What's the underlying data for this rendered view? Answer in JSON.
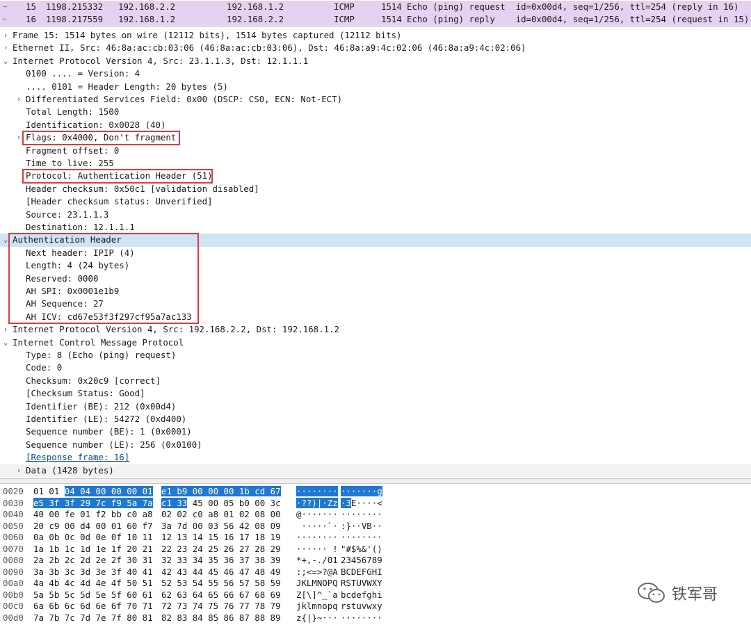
{
  "packet_list": [
    {
      "no": "15",
      "time": "1198.215332",
      "src": "192.168.2.2",
      "dst": "192.168.1.2",
      "proto": "ICMP",
      "len": "1514",
      "info": "Echo (ping) request  id=0x00d4, seq=1/256, ttl=254 (reply in 16)",
      "gutter": "→"
    },
    {
      "no": "16",
      "time": "1198.217559",
      "src": "192.168.1.2",
      "dst": "192.168.2.2",
      "proto": "ICMP",
      "len": "1514",
      "info": "Echo (ping) reply    id=0x00d4, seq=1/256, ttl=254 (request in 15)",
      "gutter": "←"
    }
  ],
  "details": [
    {
      "indent": 0,
      "toggle": "›",
      "text": "Frame 15: 1514 bytes on wire (12112 bits), 1514 bytes captured (12112 bits)"
    },
    {
      "indent": 0,
      "toggle": "›",
      "text": "Ethernet II, Src: 46:8a:ac:cb:03:06 (46:8a:ac:cb:03:06), Dst: 46:8a:a9:4c:02:06 (46:8a:a9:4c:02:06)"
    },
    {
      "indent": 0,
      "toggle": "⌄",
      "text": "Internet Protocol Version 4, Src: 23.1.1.3, Dst: 12.1.1.1"
    },
    {
      "indent": 1,
      "toggle": "",
      "text": "0100 .... = Version: 4"
    },
    {
      "indent": 1,
      "toggle": "",
      "text": ".... 0101 = Header Length: 20 bytes (5)"
    },
    {
      "indent": 1,
      "toggle": "›",
      "text": "Differentiated Services Field: 0x00 (DSCP: CS0, ECN: Not-ECT)"
    },
    {
      "indent": 1,
      "toggle": "",
      "text": "Total Length: 1500"
    },
    {
      "indent": 1,
      "toggle": "",
      "text": "Identification: 0x0028 (40)"
    },
    {
      "indent": 1,
      "toggle": "›",
      "text": "Flags: 0x4000, Don't fragment"
    },
    {
      "indent": 1,
      "toggle": "",
      "text": "Fragment offset: 0"
    },
    {
      "indent": 1,
      "toggle": "",
      "text": "Time to live: 255"
    },
    {
      "indent": 1,
      "toggle": "",
      "text": "Protocol: Authentication Header (51)"
    },
    {
      "indent": 1,
      "toggle": "",
      "text": "Header checksum: 0x50c1 [validation disabled]"
    },
    {
      "indent": 1,
      "toggle": "",
      "text": "[Header checksum status: Unverified]"
    },
    {
      "indent": 1,
      "toggle": "",
      "text": "Source: 23.1.1.3"
    },
    {
      "indent": 1,
      "toggle": "",
      "text": "Destination: 12.1.1.1"
    },
    {
      "indent": 0,
      "toggle": "⌄",
      "text": "Authentication Header",
      "selected": true
    },
    {
      "indent": 1,
      "toggle": "",
      "text": "Next header: IPIP (4)"
    },
    {
      "indent": 1,
      "toggle": "",
      "text": "Length: 4 (24 bytes)"
    },
    {
      "indent": 1,
      "toggle": "",
      "text": "Reserved: 0000"
    },
    {
      "indent": 1,
      "toggle": "",
      "text": "AH SPI: 0x0001e1b9"
    },
    {
      "indent": 1,
      "toggle": "",
      "text": "AH Sequence: 27"
    },
    {
      "indent": 1,
      "toggle": "",
      "text": "AH ICV: cd67e53f3f297cf95a7ac133"
    },
    {
      "indent": 0,
      "toggle": "›",
      "text": "Internet Protocol Version 4, Src: 192.168.2.2, Dst: 192.168.1.2"
    },
    {
      "indent": 0,
      "toggle": "⌄",
      "text": "Internet Control Message Protocol"
    },
    {
      "indent": 1,
      "toggle": "",
      "text": "Type: 8 (Echo (ping) request)"
    },
    {
      "indent": 1,
      "toggle": "",
      "text": "Code: 0"
    },
    {
      "indent": 1,
      "toggle": "",
      "text": "Checksum: 0x20c9 [correct]"
    },
    {
      "indent": 1,
      "toggle": "",
      "text": "[Checksum Status: Good]"
    },
    {
      "indent": 1,
      "toggle": "",
      "text": "Identifier (BE): 212 (0x00d4)"
    },
    {
      "indent": 1,
      "toggle": "",
      "text": "Identifier (LE): 54272 (0xd400)"
    },
    {
      "indent": 1,
      "toggle": "",
      "text": "Sequence number (BE): 1 (0x0001)"
    },
    {
      "indent": 1,
      "toggle": "",
      "text": "Sequence number (LE): 256 (0x0100)"
    },
    {
      "indent": 1,
      "toggle": "",
      "text": "[Response frame: 16]",
      "link": true
    },
    {
      "indent": 1,
      "toggle": "›",
      "text": "Data (1428 bytes)",
      "dim": true
    }
  ],
  "bytes": [
    {
      "off": "0020",
      "h1": "01 01 ",
      "h1s": "04 04 00 00 00 01",
      "h2": "",
      "h2s": "e1 b9 00 00 00 1b cd 67",
      "a1": "",
      "a1s": "········",
      "a2": "",
      "a2s": "·······g"
    },
    {
      "off": "0030",
      "h1": "",
      "h1s": "e5 3f 3f 29 7c f9 5a 7a",
      "h2": " 45 00 05 b0 00 3c",
      "h2s": "c1 33",
      "a1": "",
      "a1s": "·??)|·Zz",
      "a2": "E····<",
      "a2s": "·3"
    },
    {
      "off": "0040",
      "h1": "40 00 fe 01 f2 bb c0 a8",
      "h2": "02 02 c0 a8 01 02 08 00",
      "a1": "@·······",
      "a2": "········"
    },
    {
      "off": "0050",
      "h1": "20 c9 00 d4 00 01 60 f7",
      "h2": "3a 7d 00 03 56 42 08 09",
      "a1": " ·····`·",
      "a2": ":}··VB··"
    },
    {
      "off": "0060",
      "h1": "0a 0b 0c 0d 0e 0f 10 11",
      "h2": "12 13 14 15 16 17 18 19",
      "a1": "········",
      "a2": "········"
    },
    {
      "off": "0070",
      "h1": "1a 1b 1c 1d 1e 1f 20 21",
      "h2": "22 23 24 25 26 27 28 29",
      "a1": "······ !",
      "a2": "\"#$%&'()"
    },
    {
      "off": "0080",
      "h1": "2a 2b 2c 2d 2e 2f 30 31",
      "h2": "32 33 34 35 36 37 38 39",
      "a1": "*+,-./01",
      "a2": "23456789"
    },
    {
      "off": "0090",
      "h1": "3a 3b 3c 3d 3e 3f 40 41",
      "h2": "42 43 44 45 46 47 48 49",
      "a1": ":;<=>?@A",
      "a2": "BCDEFGHI"
    },
    {
      "off": "00a0",
      "h1": "4a 4b 4c 4d 4e 4f 50 51",
      "h2": "52 53 54 55 56 57 58 59",
      "a1": "JKLMNOPQ",
      "a2": "RSTUVWXY"
    },
    {
      "off": "00b0",
      "h1": "5a 5b 5c 5d 5e 5f 60 61",
      "h2": "62 63 64 65 66 67 68 69",
      "a1": "Z[\\]^_`a",
      "a2": "bcdefghi"
    },
    {
      "off": "00c0",
      "h1": "6a 6b 6c 6d 6e 6f 70 71",
      "h2": "72 73 74 75 76 77 78 79",
      "a1": "jklmnopq",
      "a2": "rstuvwxy"
    },
    {
      "off": "00d0",
      "h1": "7a 7b 7c 7d 7e 7f 80 81",
      "h2": "82 83 84 85 86 87 88 89",
      "a1": "z{|}~···",
      "a2": "········"
    }
  ],
  "watermark": {
    "text": "铁军哥",
    "icon": "wechat-icon"
  },
  "colors": {
    "highlight_box": "#e8363b",
    "selection": "#1f78d1",
    "selected_row": "#cde3f6",
    "packet_row": "#e4d2f0"
  }
}
